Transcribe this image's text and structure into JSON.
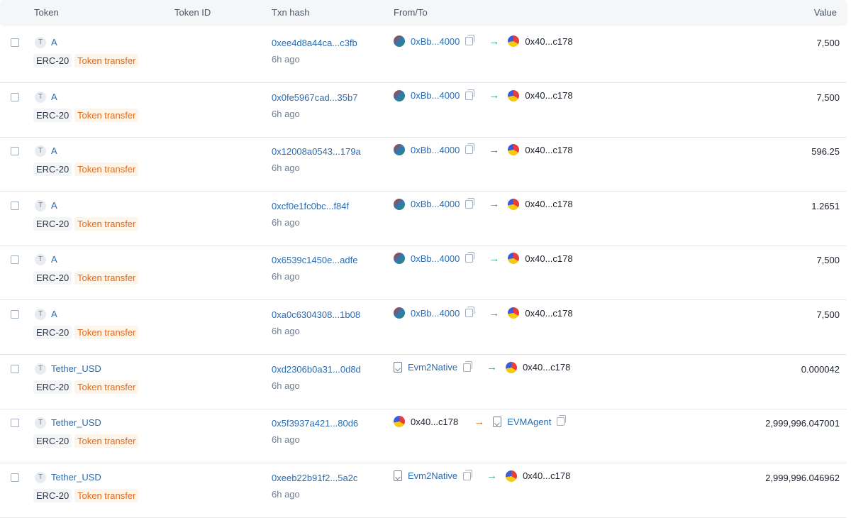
{
  "header": {
    "token": "Token",
    "token_id": "Token ID",
    "txn_hash": "Txn hash",
    "from_to": "From/To",
    "value": "Value"
  },
  "icons": {
    "token_letter": "T",
    "arrow_glyph": "→"
  },
  "colors": {
    "link": "#2b6cb0",
    "badge_transfer": "#dd6b20",
    "arrow_in": "#38a169",
    "arrow_out": "#dd6b20"
  },
  "rows": [
    {
      "token": "A",
      "standard": "ERC-20",
      "type": "Token transfer",
      "hash": "0xee4d8a44ca...c3fb",
      "age": "6h ago",
      "from": "0xBb...4000",
      "from_kind": "address",
      "to": "0x40...c178",
      "to_kind": "address",
      "direction": "in",
      "value": "7,500"
    },
    {
      "token": "A",
      "standard": "ERC-20",
      "type": "Token transfer",
      "hash": "0x0fe5967cad...35b7",
      "age": "6h ago",
      "from": "0xBb...4000",
      "from_kind": "address",
      "to": "0x40...c178",
      "to_kind": "address",
      "direction": "in",
      "value": "7,500"
    },
    {
      "token": "A",
      "standard": "ERC-20",
      "type": "Token transfer",
      "hash": "0x12008a0543...179a",
      "age": "6h ago",
      "from": "0xBb...4000",
      "from_kind": "address",
      "to": "0x40...c178",
      "to_kind": "address",
      "direction": "in",
      "value": "596.25"
    },
    {
      "token": "A",
      "standard": "ERC-20",
      "type": "Token transfer",
      "hash": "0xcf0e1fc0bc...f84f",
      "age": "6h ago",
      "from": "0xBb...4000",
      "from_kind": "address",
      "to": "0x40...c178",
      "to_kind": "address",
      "direction": "in",
      "value": "1.2651"
    },
    {
      "token": "A",
      "standard": "ERC-20",
      "type": "Token transfer",
      "hash": "0x6539c1450e...adfe",
      "age": "6h ago",
      "from": "0xBb...4000",
      "from_kind": "address",
      "to": "0x40...c178",
      "to_kind": "address",
      "direction": "in",
      "value": "7,500"
    },
    {
      "token": "A",
      "standard": "ERC-20",
      "type": "Token transfer",
      "hash": "0xa0c6304308...1b08",
      "age": "6h ago",
      "from": "0xBb...4000",
      "from_kind": "address",
      "to": "0x40...c178",
      "to_kind": "address",
      "direction": "in",
      "value": "7,500"
    },
    {
      "token": "Tether_USD",
      "standard": "ERC-20",
      "type": "Token transfer",
      "hash": "0xd2306b0a31...0d8d",
      "age": "6h ago",
      "from": "Evm2Native",
      "from_kind": "contract",
      "to": "0x40...c178",
      "to_kind": "address",
      "direction": "in",
      "value": "0.000042"
    },
    {
      "token": "Tether_USD",
      "standard": "ERC-20",
      "type": "Token transfer",
      "hash": "0x5f3937a421...80d6",
      "age": "6h ago",
      "from": "0x40...c178",
      "from_kind": "self",
      "to": "EVMAgent",
      "to_kind": "contract",
      "direction": "out",
      "value": "2,999,996.047001"
    },
    {
      "token": "Tether_USD",
      "standard": "ERC-20",
      "type": "Token transfer",
      "hash": "0xeeb22b91f2...5a2c",
      "age": "6h ago",
      "from": "Evm2Native",
      "from_kind": "contract",
      "to": "0x40...c178",
      "to_kind": "address",
      "direction": "in",
      "value": "2,999,996.046962"
    }
  ]
}
